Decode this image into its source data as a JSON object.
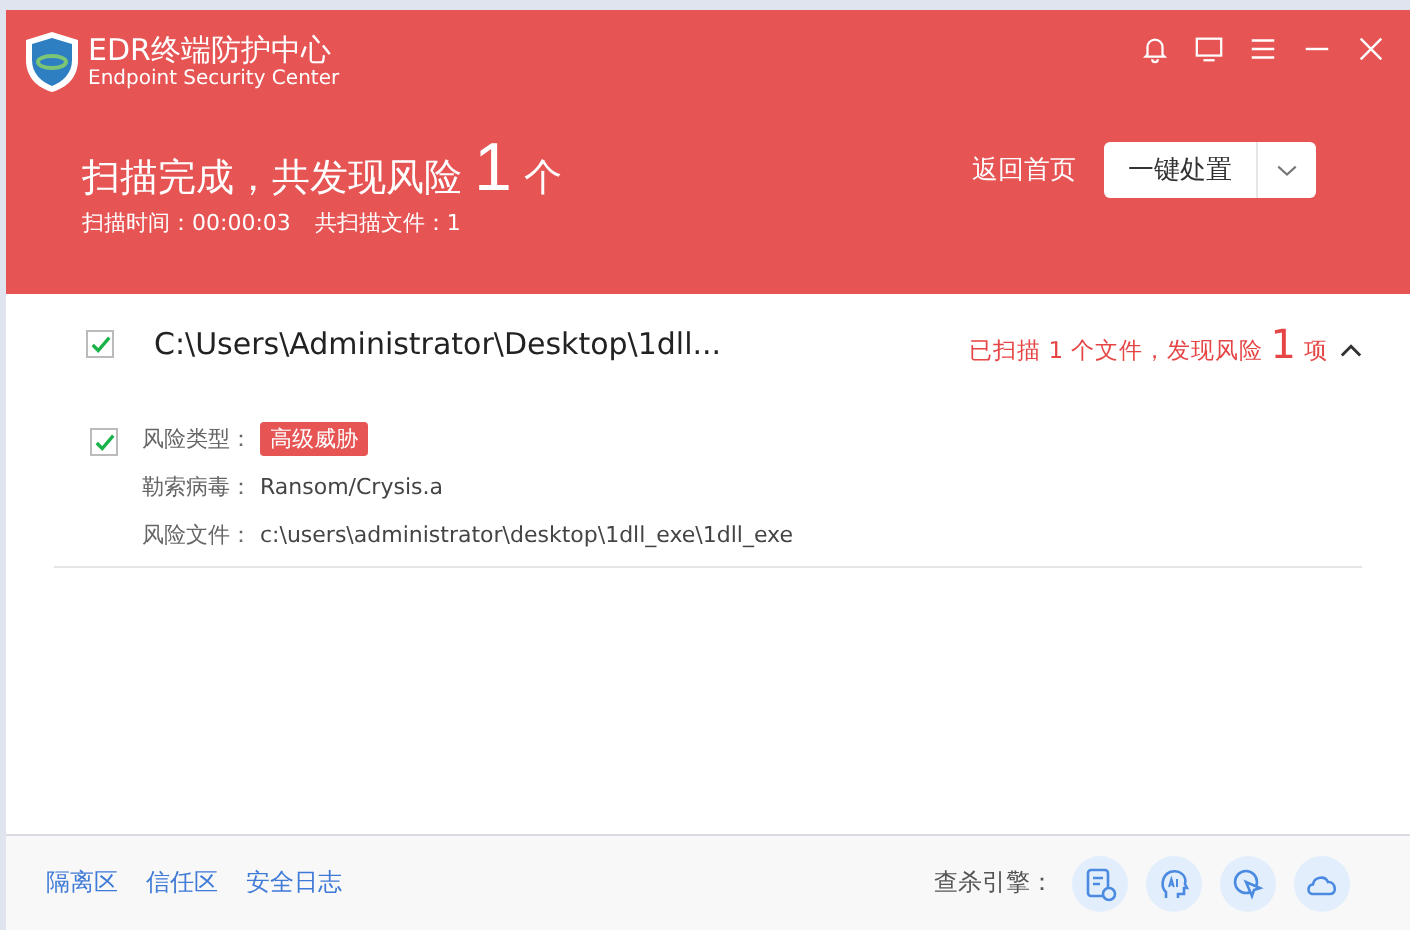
{
  "window": {
    "title": "EDR终端防护中心",
    "subtitle": "Endpoint Security Center"
  },
  "header": {
    "summary_prefix": "扫描完成，共发现风险",
    "risk_count": "1",
    "summary_suffix": "个",
    "scan_time": "扫描时间：00:00:03",
    "files_scanned": "共扫描文件：1",
    "home_link": "返回首页",
    "action_button": "一键处置"
  },
  "results": [
    {
      "path": "C:\\Users\\Administrator\\Desktop\\1dll...",
      "checked": true,
      "expanded": true,
      "stat_prefix": "已扫描 1 个文件，发现风险",
      "stat_count": "1",
      "stat_suffix": "项",
      "threats": [
        {
          "checked": true,
          "fields": [
            {
              "label": "风险类型：",
              "value": "高级威胁",
              "kind": "tag"
            },
            {
              "label": "勒索病毒：",
              "value": "Ransom/Crysis.a",
              "kind": "text"
            },
            {
              "label": "风险文件：",
              "value": "c:\\users\\administrator\\desktop\\1dll_exe\\1dll_exe",
              "kind": "text"
            }
          ]
        }
      ]
    }
  ],
  "footer": {
    "links": [
      "隔离区",
      "信任区",
      "安全日志"
    ],
    "engines_label": "查杀引擎："
  }
}
